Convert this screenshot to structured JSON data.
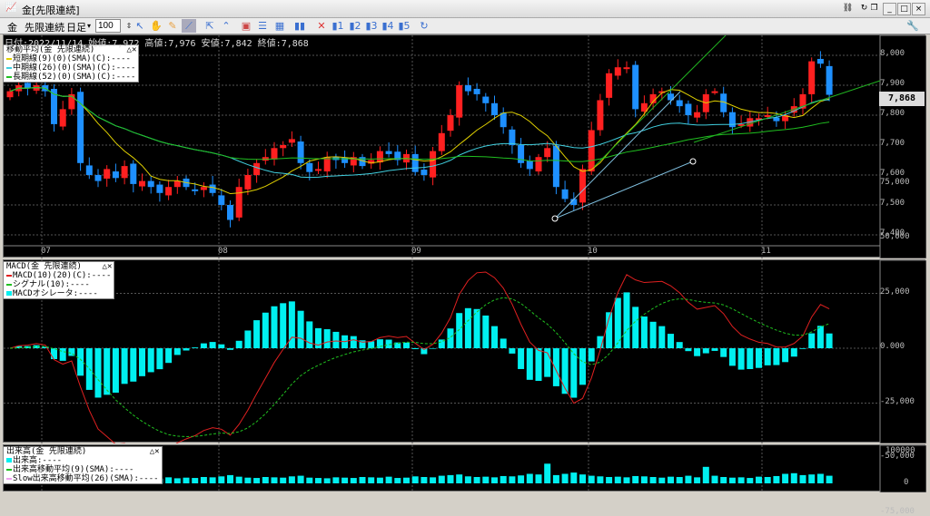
{
  "window": {
    "title": "金[先限連続]"
  },
  "toolbar": {
    "commodity": "金",
    "contract": "先限連続",
    "period": "日足",
    "bars": "100"
  },
  "info": {
    "text": "日付:2022/11/14 始値:7,972 高値:7,976 安値:7,842 終値:7,868"
  },
  "ma_legend": {
    "title": "移動平均(金 先限連続)",
    "items": [
      {
        "label": "短期線(9)(0)(SMA)(C):----",
        "color": "#e0d000"
      },
      {
        "label": "中期線(26)(0)(SMA)(C):----",
        "color": "#40d0e0"
      },
      {
        "label": "長期線(52)(0)(SMA)(C):----",
        "color": "#20c020"
      }
    ]
  },
  "macd_legend": {
    "title": "MACD(金 先限連続)",
    "items": [
      {
        "label": "MACD(10)(20)(C):----",
        "color": "#e02020"
      },
      {
        "label": "シグナル(10):----",
        "color": "#20c020"
      },
      {
        "label": "MACDオシレータ:----",
        "color": "#00f0f0"
      }
    ]
  },
  "vol_legend": {
    "title": "出来高(金 先限連続)",
    "items": [
      {
        "label": "出来高:----",
        "color": "#00f0f0"
      },
      {
        "label": "出来高移動平均(9)(SMA):----",
        "color": "#20c020"
      },
      {
        "label": "Slow出来高移動平均(26)(SMA):----",
        "color": "#f0a0f0"
      }
    ]
  },
  "price_axis": [
    "8,000",
    "7,900",
    "7,800",
    "7,700",
    "7,600",
    "7,500",
    "7,400"
  ],
  "current_price": "7,868",
  "macd_axis": [
    "75,000",
    "50,000",
    "25,000",
    "0.000",
    "-25,000",
    "-50,000",
    "-75,000"
  ],
  "vol_axis": [
    "100000",
    "0"
  ],
  "date_labels": [
    "07",
    "08",
    "09",
    "10",
    "11"
  ],
  "colors": {
    "up": "#ff2020",
    "down": "#1e90ff",
    "bg": "#000000"
  },
  "closes": [
    7880,
    7900,
    7890,
    7900,
    7880,
    7770,
    7820,
    7870,
    7640,
    7600,
    7580,
    7620,
    7590,
    7630,
    7570,
    7580,
    7560,
    7540,
    7560,
    7580,
    7560,
    7550,
    7560,
    7540,
    7500,
    7450,
    7560,
    7600,
    7640,
    7660,
    7690,
    7700,
    7720,
    7640,
    7610,
    7620,
    7660,
    7650,
    7640,
    7660,
    7630,
    7650,
    7680,
    7670,
    7650,
    7670,
    7610,
    7600,
    7680,
    7740,
    7800,
    7900,
    7880,
    7870,
    7840,
    7800,
    7760,
    7700,
    7640,
    7620,
    7660,
    7690,
    7560,
    7520,
    7500,
    7620,
    7750,
    7850,
    7940,
    7960,
    7960,
    7820,
    7840,
    7870,
    7880,
    7850,
    7830,
    7800,
    7810,
    7870,
    7880,
    7810,
    7760,
    7770,
    7790,
    7790,
    7800,
    7780,
    7800,
    7830,
    7870,
    7980,
    7972,
    7868
  ],
  "volumes": [
    18000,
    16000,
    20000,
    17000,
    22000,
    25000,
    19000,
    21000,
    24000,
    20000,
    18000,
    17000,
    19000,
    16000,
    18000,
    20000,
    17000,
    15000,
    19000,
    16000,
    18000,
    17000,
    20000,
    19000,
    22000,
    26000,
    21000,
    18000,
    17000,
    20000,
    19000,
    18000,
    22000,
    24000,
    18000,
    17000,
    16000,
    19000,
    18000,
    17000,
    20000,
    19000,
    18000,
    21000,
    17000,
    18000,
    22000,
    20000,
    19000,
    24000,
    26000,
    28000,
    22000,
    20000,
    21000,
    19000,
    23000,
    22000,
    25000,
    30000,
    28000,
    62000,
    26000,
    30000,
    34000,
    28000,
    24000,
    22000,
    20000,
    21000,
    19000,
    23000,
    22000,
    20000,
    18000,
    21000,
    20000,
    24000,
    19000,
    52000,
    24000,
    20000,
    18000,
    19000,
    17000,
    21000,
    20000,
    23000,
    30000,
    32000,
    26000,
    28000,
    30000,
    24000
  ]
}
